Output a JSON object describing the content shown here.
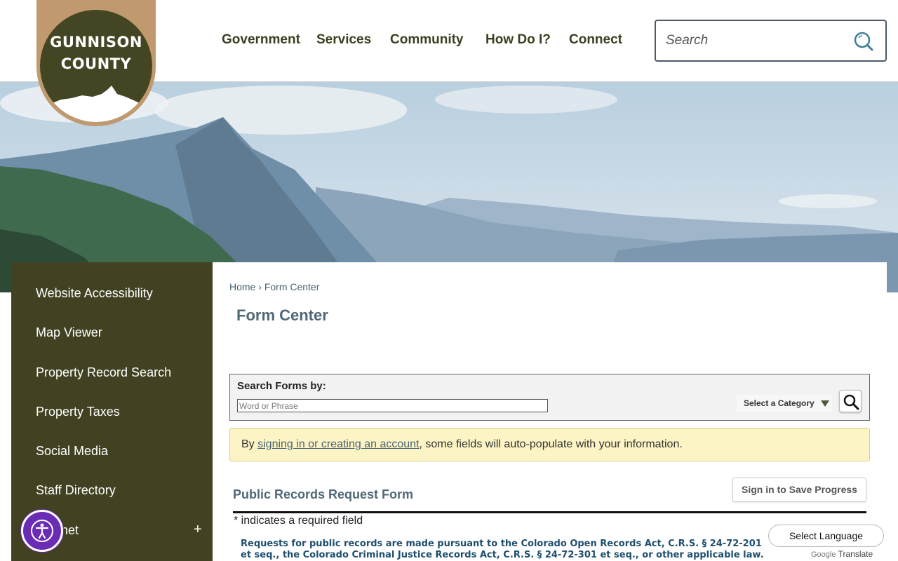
{
  "header": {
    "logo_line1": "GUNNISON",
    "logo_line2": "COUNTY",
    "nav": [
      "Government",
      "Services",
      "Community",
      "How Do I?",
      "Connect"
    ],
    "search_placeholder": "Search"
  },
  "sidebar": {
    "items": [
      "Website Accessibility",
      "Map Viewer",
      "Property Record Search",
      "Property Taxes",
      "Social Media",
      "Staff Directory",
      "Intranet"
    ],
    "expand_symbol": "+"
  },
  "breadcrumb": {
    "home": "Home",
    "separator": "›",
    "current": "Form Center"
  },
  "page_title": "Form Center",
  "search_forms": {
    "label": "Search Forms by:",
    "placeholder": "Word or Phrase",
    "category_label": "Select a Category"
  },
  "notice": {
    "prefix": "By ",
    "link": "signing in or creating an account",
    "suffix": ", some fields will auto-populate with your information."
  },
  "form": {
    "title": "Public Records Request Form",
    "save_button": "Sign in to Save Progress",
    "required_note": "* indicates a required field",
    "legal_text": "Requests for public records are made pursuant to the Colorado Open Records Act, C.R.S. § 24-72-201 et seq., the Colorado Criminal Justice Records Act, C.R.S. § 24-72-301 et seq., or other applicable law."
  },
  "translate": {
    "select_label": "Select Language",
    "powered_google": "Google",
    "powered_translate": "Translate"
  },
  "colors": {
    "brand_olive": "#424223",
    "brand_tan": "#c09a6e",
    "link_slate": "#4b6473",
    "notice_bg": "#fcf4c4",
    "accessibility_purple": "#6a2bb5"
  }
}
